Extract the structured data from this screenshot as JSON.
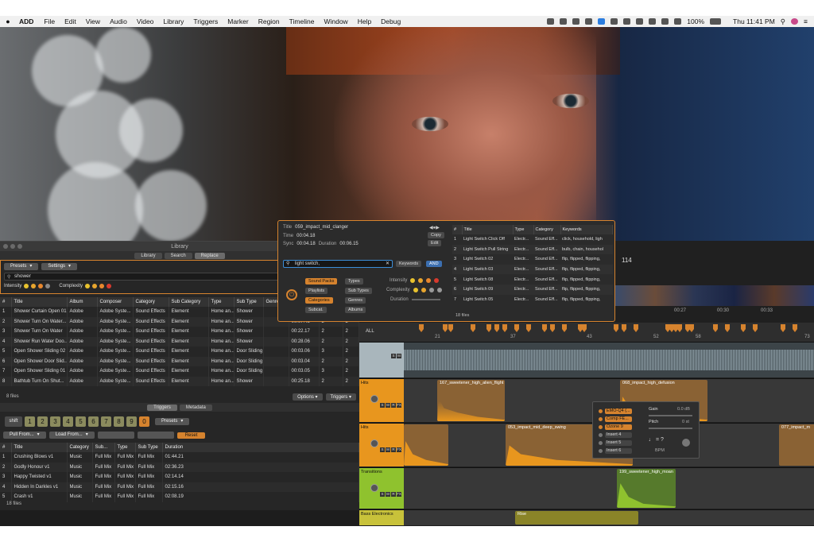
{
  "menubar": {
    "app": "ADD",
    "menus": [
      "File",
      "Edit",
      "View",
      "Audio",
      "Video",
      "Library",
      "Triggers",
      "Marker",
      "Region",
      "Timeline",
      "Window",
      "Help",
      "Debug"
    ],
    "battery": "100%",
    "clock": "Thu 11:41 PM"
  },
  "library": {
    "title": "Library",
    "tabs": [
      "Library",
      "Search",
      "Replace"
    ],
    "presets": "Presets",
    "settings": "Settings",
    "query": "shower",
    "intensity_label": "Intensity",
    "complexity_label": "Complexity",
    "columns": [
      "#",
      "Title",
      "Album",
      "Composer",
      "Category",
      "Sub Category",
      "Type",
      "Sub Type",
      "Genre"
    ],
    "rows": [
      [
        "1",
        "Shower Curtain Open 01",
        "Adobe",
        "Adobe Syste...",
        "Sound Effects",
        "Element",
        "Home an...",
        "Shower",
        "",
        "00:15.23",
        "2",
        "2"
      ],
      [
        "2",
        "Shower Turn On Water...",
        "Adobe",
        "Adobe Syste...",
        "Sound Effects",
        "Element",
        "Home an...",
        "Shower",
        "",
        "00:07.48",
        "2",
        "2"
      ],
      [
        "3",
        "Shower Turn On Water",
        "Adobe",
        "Adobe Syste...",
        "Sound Effects",
        "Element",
        "Home an...",
        "Shower",
        "",
        "00:22.17",
        "2",
        "2"
      ],
      [
        "4",
        "Shower Run Water Doo...",
        "Adobe",
        "Adobe Syste...",
        "Sound Effects",
        "Element",
        "Home an...",
        "Shower",
        "",
        "00:28.06",
        "2",
        "2"
      ],
      [
        "5",
        "Open Shower Sliding 02",
        "Adobe",
        "Adobe Syste...",
        "Sound Effects",
        "Element",
        "Home an...",
        "Door Sliding",
        "",
        "00:03.06",
        "3",
        "2"
      ],
      [
        "6",
        "Open Shower Door Slid...",
        "Adobe",
        "Adobe Syste...",
        "Sound Effects",
        "Element",
        "Home an...",
        "Door Sliding",
        "",
        "00:03.04",
        "2",
        "2"
      ],
      [
        "7",
        "Open Shower Sliding 01",
        "Adobe",
        "Adobe Syste...",
        "Sound Effects",
        "Element",
        "Home an...",
        "Door Sliding",
        "",
        "00:03.05",
        "3",
        "2"
      ],
      [
        "8",
        "Bathtub Turn On Shut...",
        "Adobe",
        "Adobe Syste...",
        "Sound Effects",
        "Element",
        "Home an...",
        "Shower",
        "",
        "00:25.18",
        "2",
        "2"
      ]
    ],
    "file_count": "8 files",
    "options": "Options",
    "triggers": "Triggers"
  },
  "triggers_pane": {
    "tabs": [
      "Triggers",
      "Metadata"
    ],
    "shift": "shift",
    "keys": [
      "1",
      "2",
      "3",
      "4",
      "5",
      "6",
      "7",
      "8",
      "9",
      "0"
    ],
    "presets": "Presets",
    "pull_from": "Pull From...",
    "load_from": "Load From...",
    "reset": "Reset",
    "columns": [
      "#",
      "Title",
      "Category",
      "Sub...",
      "Type",
      "Sub Type",
      "Duration"
    ],
    "rows": [
      [
        "1",
        "Crushing Blows v1",
        "Music",
        "Full Mix",
        "Full Mix",
        "Full Mix",
        "01:44.21"
      ],
      [
        "2",
        "Godly Honour v1",
        "Music",
        "Full Mix",
        "Full Mix",
        "Full Mix",
        "02:36.23"
      ],
      [
        "3",
        "Happy Twisted v1",
        "Music",
        "Full Mix",
        "Full Mix",
        "Full Mix",
        "02:14.14"
      ],
      [
        "4",
        "Hidden In Darkles v1",
        "Music",
        "Full Mix",
        "Full Mix",
        "Full Mix",
        "02:15.16"
      ],
      [
        "5",
        "Crash v1",
        "Music",
        "Full Mix",
        "Full Mix",
        "Full Mix",
        "02:08.19"
      ]
    ],
    "file_count": "18 files"
  },
  "search_popup": {
    "title_label": "Title",
    "title_value": "059_impact_mid_clanger",
    "time_label": "Time",
    "time_value": "00:04.18",
    "sync_label": "Sync",
    "sync_value": "00:04.18",
    "duration_label": "Duration",
    "duration_value": "00:06.15",
    "copy": "Copy",
    "edit": "Edit",
    "query": "light switch,",
    "keywords": "Keywords",
    "and": "AND",
    "filters_left": [
      "Sound Packs",
      "Playlists",
      "Categories",
      "Subcat."
    ],
    "filters_right": [
      "Types",
      "Sub Types",
      "Genres",
      "Albums"
    ],
    "intensity": "Intensity",
    "complexity": "Complexity",
    "duration": "Duration",
    "columns": [
      "#",
      "Title",
      "Type",
      "Category",
      "Keywords"
    ],
    "rows": [
      [
        "1",
        "Light Switch Click Off",
        "Electr...",
        "Sound Eff...",
        "click, household, ligh"
      ],
      [
        "2",
        "Light Switch Pull String",
        "Electr...",
        "Sound Eff...",
        "bulb, chain, househol"
      ],
      [
        "3",
        "Light Switch 02",
        "Electr...",
        "Sound Eff...",
        "flip, flipped, flipping,"
      ],
      [
        "4",
        "Light Switch 03",
        "Electr...",
        "Sound Eff...",
        "flip, flipped, flipping,"
      ],
      [
        "5",
        "Light Switch 08",
        "Electr...",
        "Sound Eff...",
        "flip, flipped, flipping,"
      ],
      [
        "6",
        "Light Switch 09",
        "Electr...",
        "Sound Eff...",
        "flip, flipped, flipping,"
      ],
      [
        "7",
        "Light Switch 05",
        "Electr...",
        "Sound Eff...",
        "flip, flipped, flipping,"
      ]
    ],
    "file_count": "18 files"
  },
  "timeline": {
    "counter": "114",
    "all_label": "ALL",
    "ruler_numbers": [
      "21",
      "37",
      "43",
      "52",
      "58",
      "73"
    ],
    "overview_times": [
      "00:27",
      "00:30",
      "00:33"
    ],
    "tracks": [
      {
        "name": "",
        "color": "#a9b6bc"
      },
      {
        "name": "Hits",
        "color": "#e8961e"
      },
      {
        "name": "Hits",
        "color": "#e8961e"
      },
      {
        "name": "Transitions",
        "color": "#8fc22e"
      },
      {
        "name": "Bass Electronics",
        "color": "#c8c23a"
      }
    ],
    "clips": [
      "167_sweetener_high_alien_flight",
      "068_impact_high_defusion",
      "053_impact_mid_deep_swing",
      "077_impact_m",
      "199_sweetener_high_moan",
      "Rise"
    ],
    "ms_labels": [
      "S",
      "M",
      "R",
      "FX"
    ]
  },
  "inserts": {
    "items": [
      "EMO-Q4 (...",
      "Comp FE...",
      "Ozone 9",
      "Insert 4",
      "Insert 5",
      "Insert 6"
    ],
    "gain_label": "Gain",
    "gain_value": "0.0 dB",
    "pitch_label": "Pitch",
    "pitch_value": "0 st",
    "tempo": "♩ = ?",
    "bpm": "BPM"
  }
}
